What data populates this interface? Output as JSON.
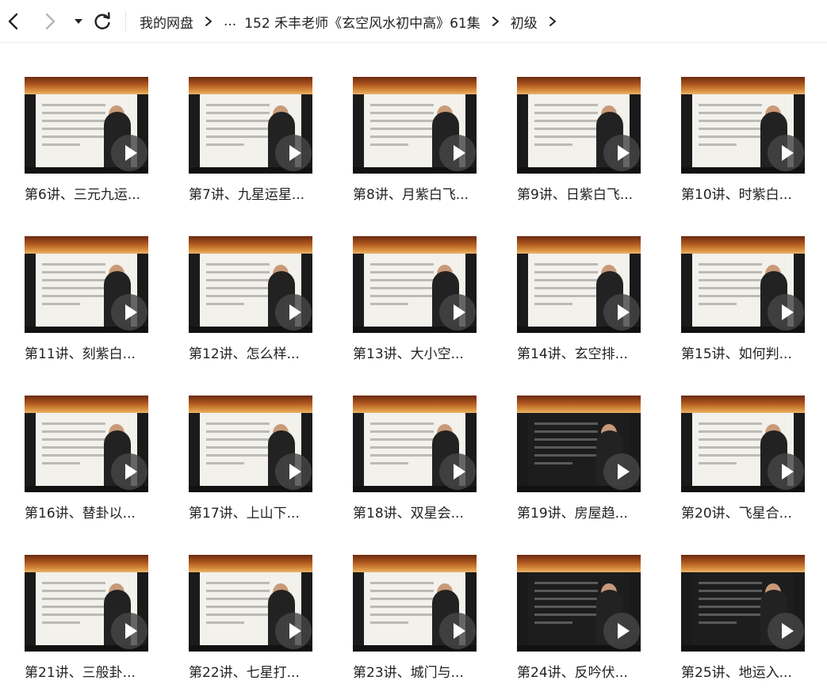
{
  "nav": {
    "back_icon": "chevron-left-icon",
    "forward_icon": "chevron-right-icon",
    "dropdown_icon": "caret-down-icon",
    "refresh_icon": "refresh-icon"
  },
  "breadcrumb": {
    "root": "我的网盘",
    "ellipsis": "...",
    "folder": "152 禾丰老师《玄空风水初中高》61集",
    "current": "初级"
  },
  "videos": [
    {
      "title": "第6讲、三元九运..."
    },
    {
      "title": "第7讲、九星运星..."
    },
    {
      "title": "第8讲、月紫白飞..."
    },
    {
      "title": "第9讲、日紫白飞..."
    },
    {
      "title": "第10讲、时紫白..."
    },
    {
      "title": "第11讲、刻紫白..."
    },
    {
      "title": "第12讲、怎么样..."
    },
    {
      "title": "第13讲、大小空..."
    },
    {
      "title": "第14讲、玄空排..."
    },
    {
      "title": "第15讲、如何判..."
    },
    {
      "title": "第16讲、替卦以..."
    },
    {
      "title": "第17讲、上山下..."
    },
    {
      "title": "第18讲、双星会..."
    },
    {
      "title": "第19讲、房屋趋..."
    },
    {
      "title": "第20讲、飞星合..."
    },
    {
      "title": "第21讲、三般卦..."
    },
    {
      "title": "第22讲、七星打..."
    },
    {
      "title": "第23讲、城门与..."
    },
    {
      "title": "第24讲、反吟伏..."
    },
    {
      "title": "第25讲、地运入..."
    }
  ]
}
